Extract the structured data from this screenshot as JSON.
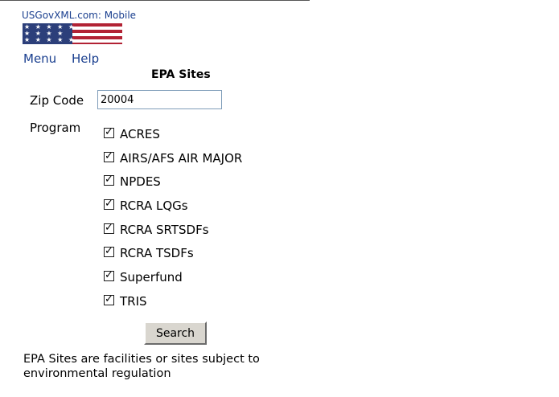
{
  "header": {
    "site_title": "USGovXML.com: Mobile"
  },
  "nav": {
    "menu_label": "Menu",
    "help_label": "Help"
  },
  "page": {
    "title": "EPA Sites"
  },
  "form": {
    "zip_label": "Zip Code",
    "zip_value": "20004",
    "program_label": "Program",
    "programs": [
      {
        "label": "ACRES",
        "checked": true
      },
      {
        "label": "AIRS/AFS AIR MAJOR",
        "checked": true
      },
      {
        "label": "NPDES",
        "checked": true
      },
      {
        "label": "RCRA LQGs",
        "checked": true
      },
      {
        "label": "RCRA SRTSDFs",
        "checked": true
      },
      {
        "label": "RCRA TSDFs",
        "checked": true
      },
      {
        "label": "Superfund",
        "checked": true
      },
      {
        "label": "TRIS",
        "checked": true
      }
    ],
    "search_label": "Search"
  },
  "footer": {
    "description": "EPA Sites are facilities or sites subject to environmental regulation"
  },
  "colors": {
    "link": "#1a3f8f",
    "flag_red": "#b22234",
    "flag_blue": "#2c3f7a"
  }
}
